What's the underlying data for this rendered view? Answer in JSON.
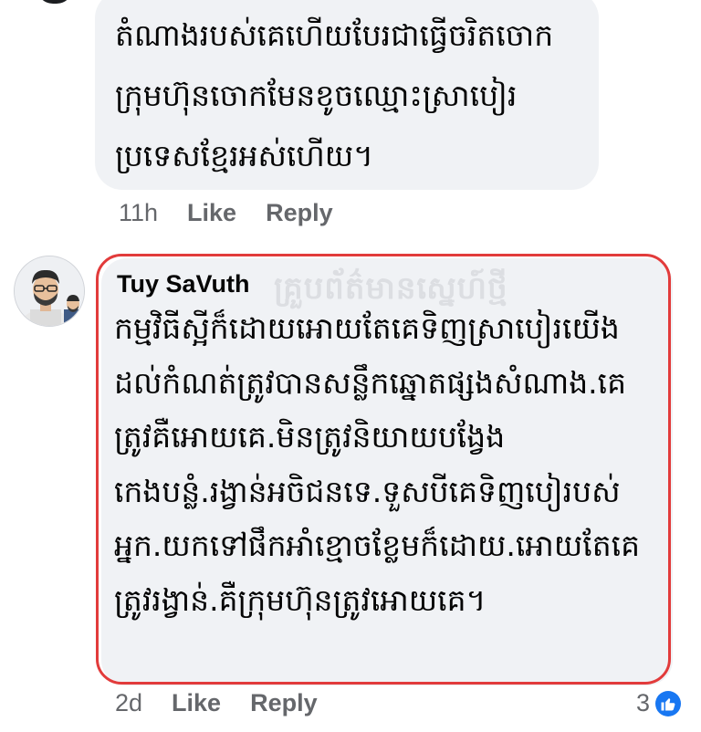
{
  "previous_comment": {
    "text_lines": "តំណាងរបស់គេហើយបែរជាធ្វើចរិតចោក\nក្រុមហ៊ុនចោកមែនខូចឈ្មោះស្រាបៀរ\nប្រទេសខ្មែរអស់ហើយ។",
    "time": "11h",
    "like_label": "Like",
    "reply_label": "Reply"
  },
  "comment": {
    "author": "Tuy SaVuth",
    "text_lines": "កម្មវិធីស្អីក៏ដោយអោយតែគេទិញស្រាបៀរយើង\nដល់កំណត់ត្រូវបានសន្លឹកឆ្នោតផ្សងសំណាង.គេ\nត្រូវគឺអោយគេ.មិនត្រូវនិយាយបង្វែង\nកេងបន្លំ.រង្វាន់អចិជនទេ.ទួសបីគេទិញបៀរបស់\nអ្នក.យកទៅផឹកអាំខ្មោចខ្លែមក៏ដោយ.អោយតែគេ\nត្រូវរង្វាន់.គឺក្រុមហ៊ុនត្រូវអោយគេ។",
    "time": "2d",
    "like_label": "Like",
    "reply_label": "Reply",
    "reaction_count": "3",
    "reaction_icon": "thumbs-up-icon",
    "highlight_color": "#e23b3b"
  },
  "watermark_text": "គ្រួបព័ត៌មានស្នេហ៍ថ្មី",
  "colors": {
    "bubble": "#f0f2f5",
    "meta_text": "#65676b",
    "like_blue": "#1877f2"
  }
}
